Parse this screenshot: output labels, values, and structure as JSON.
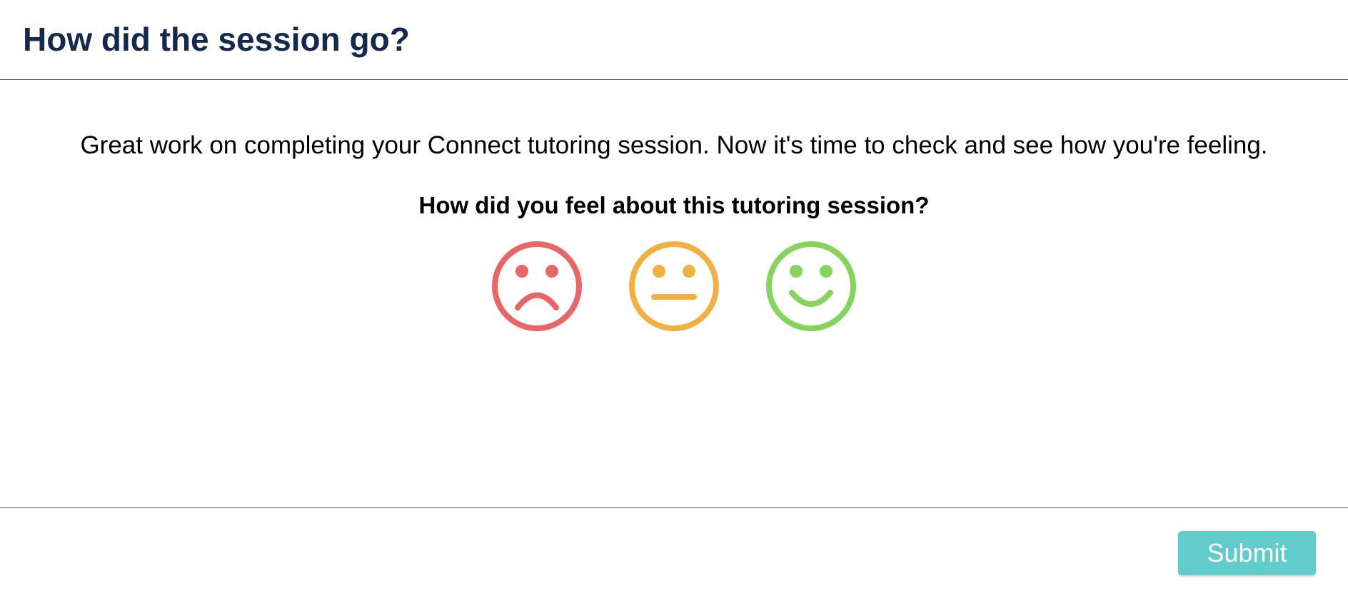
{
  "dialog": {
    "title": "How did the session go?"
  },
  "main": {
    "intro_text": "Great work on completing your Connect tutoring session. Now it's time to check and see how you're feeling.",
    "question": "How did you feel about this tutoring session?",
    "ratings": [
      {
        "icon": "sad-face-icon",
        "color": "#ea6565"
      },
      {
        "icon": "neutral-face-icon",
        "color": "#f2b043"
      },
      {
        "icon": "happy-face-icon",
        "color": "#86d35e"
      }
    ]
  },
  "footer": {
    "submit_label": "Submit"
  },
  "colors": {
    "title": "#14294b",
    "submit_bg": "#62cccc",
    "divider": "#555a60"
  }
}
